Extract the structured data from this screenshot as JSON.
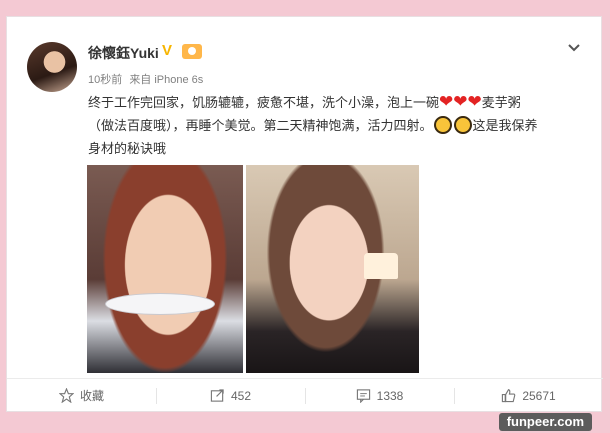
{
  "post": {
    "username": "徐懷鈺Yuki",
    "verified_badge": "V",
    "time": "10秒前",
    "source": "来自 iPhone 6s",
    "text_line1": "终于工作完回家，饥肠辘辘，疲惫不堪，洗个小澡，泡上一碗",
    "hearts": "❤❤❤",
    "text_line1_end": "麦芋粥",
    "text_line2": "（做法百度哦），再睡个美觉。第二天精神饱满，活力四射。",
    "text_line2_end": "这是我保养",
    "text_line3": "身材的秘诀哦"
  },
  "actions": {
    "favorite_label": "收藏",
    "repost_count": "452",
    "comment_count": "1338",
    "like_count": "25671"
  },
  "icons": [
    "chevron-down-icon",
    "star-icon",
    "share-icon",
    "comment-icon",
    "thumbs-up-icon",
    "laughing-emoji-icon",
    "heart-emoji-icon"
  ],
  "watermark": "funpeer.com"
}
